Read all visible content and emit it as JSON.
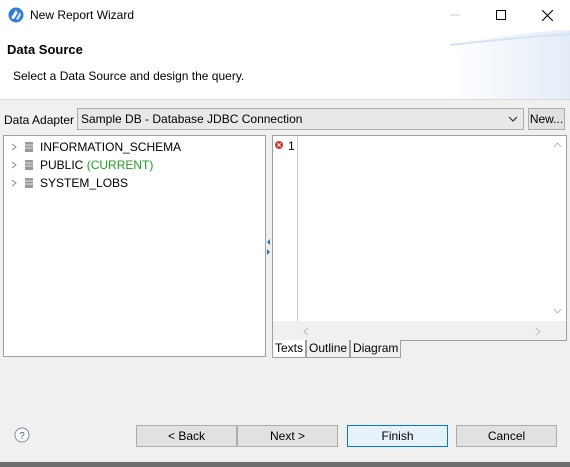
{
  "window": {
    "title": "New Report Wizard",
    "icons": {
      "app": "jaspersoft-icon",
      "minimize": "minimize-icon",
      "maximize": "maximize-icon",
      "close": "close-icon"
    }
  },
  "header": {
    "heading": "Data Source",
    "description": "Select a Data Source and design the query."
  },
  "adapter": {
    "label": "Data Adapter",
    "selected": "Sample DB - Database JDBC Connection",
    "new_button": "New..."
  },
  "tree": {
    "items": [
      {
        "name": "INFORMATION_SCHEMA",
        "suffix": ""
      },
      {
        "name": "PUBLIC",
        "suffix": "(CURRENT)"
      },
      {
        "name": "SYSTEM_LOBS",
        "suffix": ""
      }
    ]
  },
  "editor": {
    "line_number": "1"
  },
  "tabs": [
    "Texts",
    "Outline",
    "Diagram"
  ],
  "buttons": {
    "back": "< Back",
    "next": "Next >",
    "finish": "Finish",
    "cancel": "Cancel"
  },
  "colors": {
    "current_green": "#1e9e1e",
    "finish_border": "#0078d7"
  }
}
